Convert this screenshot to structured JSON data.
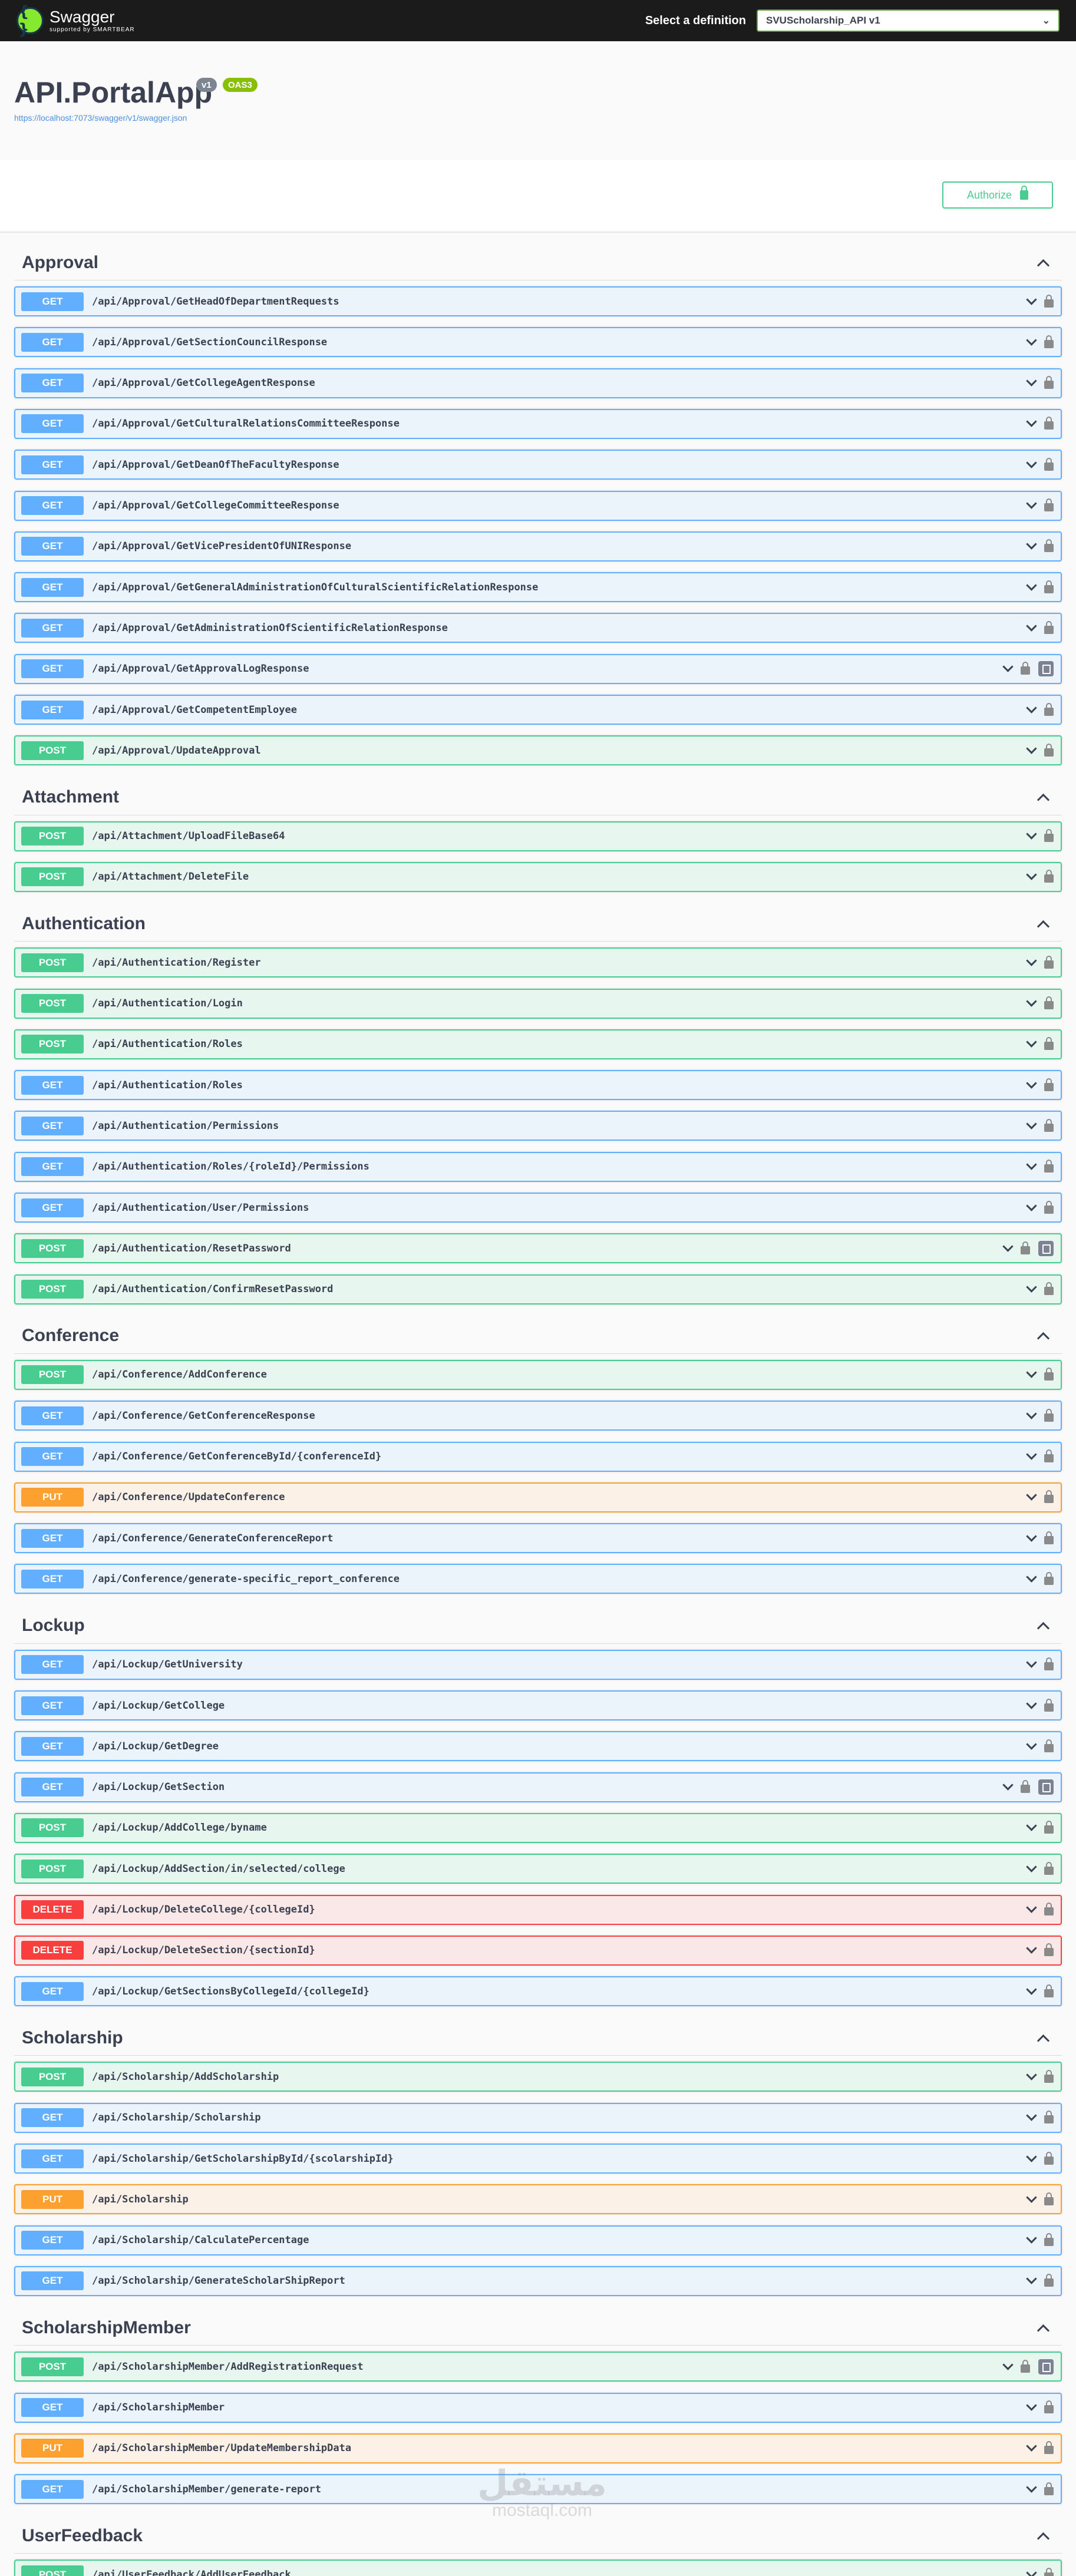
{
  "topbar": {
    "logo_glyph": "{ }",
    "logo_title": "Swagger",
    "logo_sub": "supported by SMARTBEAR",
    "definition_label": "Select a definition",
    "definition_value": "SVUScholarship_API v1"
  },
  "info": {
    "title": "API.PortalApp",
    "version": "v1",
    "oas": "OAS3",
    "url": "https://localhost:7073/swagger/v1/swagger.json"
  },
  "authorize": {
    "label": "Authorize"
  },
  "tags": [
    {
      "name": "Approval",
      "ops": [
        {
          "method": "GET",
          "path": "/api/Approval/GetHeadOfDepartmentRequests"
        },
        {
          "method": "GET",
          "path": "/api/Approval/GetSectionCouncilResponse"
        },
        {
          "method": "GET",
          "path": "/api/Approval/GetCollegeAgentResponse"
        },
        {
          "method": "GET",
          "path": "/api/Approval/GetCulturalRelationsCommitteeResponse"
        },
        {
          "method": "GET",
          "path": "/api/Approval/GetDeanOfTheFacultyResponse"
        },
        {
          "method": "GET",
          "path": "/api/Approval/GetCollegeCommitteeResponse"
        },
        {
          "method": "GET",
          "path": "/api/Approval/GetVicePresidentOfUNIResponse"
        },
        {
          "method": "GET",
          "path": "/api/Approval/GetGeneralAdministrationOfCulturalScientificRelationResponse"
        },
        {
          "method": "GET",
          "path": "/api/Approval/GetAdministrationOfScientificRelationResponse"
        },
        {
          "method": "GET",
          "path": "/api/Approval/GetApprovalLogResponse",
          "copy": true
        },
        {
          "method": "GET",
          "path": "/api/Approval/GetCompetentEmployee"
        },
        {
          "method": "POST",
          "path": "/api/Approval/UpdateApproval"
        }
      ]
    },
    {
      "name": "Attachment",
      "ops": [
        {
          "method": "POST",
          "path": "/api/Attachment/UploadFileBase64"
        },
        {
          "method": "POST",
          "path": "/api/Attachment/DeleteFile"
        }
      ]
    },
    {
      "name": "Authentication",
      "ops": [
        {
          "method": "POST",
          "path": "/api/Authentication/Register"
        },
        {
          "method": "POST",
          "path": "/api/Authentication/Login"
        },
        {
          "method": "POST",
          "path": "/api/Authentication/Roles"
        },
        {
          "method": "GET",
          "path": "/api/Authentication/Roles"
        },
        {
          "method": "GET",
          "path": "/api/Authentication/Permissions"
        },
        {
          "method": "GET",
          "path": "/api/Authentication/Roles/{roleId}/Permissions"
        },
        {
          "method": "GET",
          "path": "/api/Authentication/User/Permissions"
        },
        {
          "method": "POST",
          "path": "/api/Authentication/ResetPassword",
          "copy": true
        },
        {
          "method": "POST",
          "path": "/api/Authentication/ConfirmResetPassword"
        }
      ]
    },
    {
      "name": "Conference",
      "ops": [
        {
          "method": "POST",
          "path": "/api/Conference/AddConference"
        },
        {
          "method": "GET",
          "path": "/api/Conference/GetConferenceResponse"
        },
        {
          "method": "GET",
          "path": "/api/Conference/GetConferenceById/{conferenceId}"
        },
        {
          "method": "PUT",
          "path": "/api/Conference/UpdateConference"
        },
        {
          "method": "GET",
          "path": "/api/Conference/GenerateConferenceReport"
        },
        {
          "method": "GET",
          "path": "/api/Conference/generate-specific_report_conference"
        }
      ]
    },
    {
      "name": "Lockup",
      "ops": [
        {
          "method": "GET",
          "path": "/api/Lockup/GetUniversity"
        },
        {
          "method": "GET",
          "path": "/api/Lockup/GetCollege"
        },
        {
          "method": "GET",
          "path": "/api/Lockup/GetDegree"
        },
        {
          "method": "GET",
          "path": "/api/Lockup/GetSection",
          "copy": true
        },
        {
          "method": "POST",
          "path": "/api/Lockup/AddCollege/byname"
        },
        {
          "method": "POST",
          "path": "/api/Lockup/AddSection/in/selected/college"
        },
        {
          "method": "DELETE",
          "path": "/api/Lockup/DeleteCollege/{collegeId}"
        },
        {
          "method": "DELETE",
          "path": "/api/Lockup/DeleteSection/{sectionId}"
        },
        {
          "method": "GET",
          "path": "/api/Lockup/GetSectionsByCollegeId/{collegeId}"
        }
      ]
    },
    {
      "name": "Scholarship",
      "ops": [
        {
          "method": "POST",
          "path": "/api/Scholarship/AddScholarship"
        },
        {
          "method": "GET",
          "path": "/api/Scholarship/Scholarship"
        },
        {
          "method": "GET",
          "path": "/api/Scholarship/GetScholarshipById/{scolarshipId}"
        },
        {
          "method": "PUT",
          "path": "/api/Scholarship"
        },
        {
          "method": "GET",
          "path": "/api/Scholarship/CalculatePercentage"
        },
        {
          "method": "GET",
          "path": "/api/Scholarship/GenerateScholarShipReport"
        }
      ]
    },
    {
      "name": "ScholarshipMember",
      "ops": [
        {
          "method": "POST",
          "path": "/api/ScholarshipMember/AddRegistrationRequest",
          "copy": true
        },
        {
          "method": "GET",
          "path": "/api/ScholarshipMember"
        },
        {
          "method": "PUT",
          "path": "/api/ScholarshipMember/UpdateMembershipData"
        },
        {
          "method": "GET",
          "path": "/api/ScholarshipMember/generate-report"
        }
      ]
    },
    {
      "name": "UserFeedback",
      "ops": [
        {
          "method": "POST",
          "path": "/api/UserFeedback/AddUserFeedback"
        }
      ]
    }
  ],
  "watermark": {
    "arabic": "مستقل",
    "latin": "mostaql.com"
  }
}
